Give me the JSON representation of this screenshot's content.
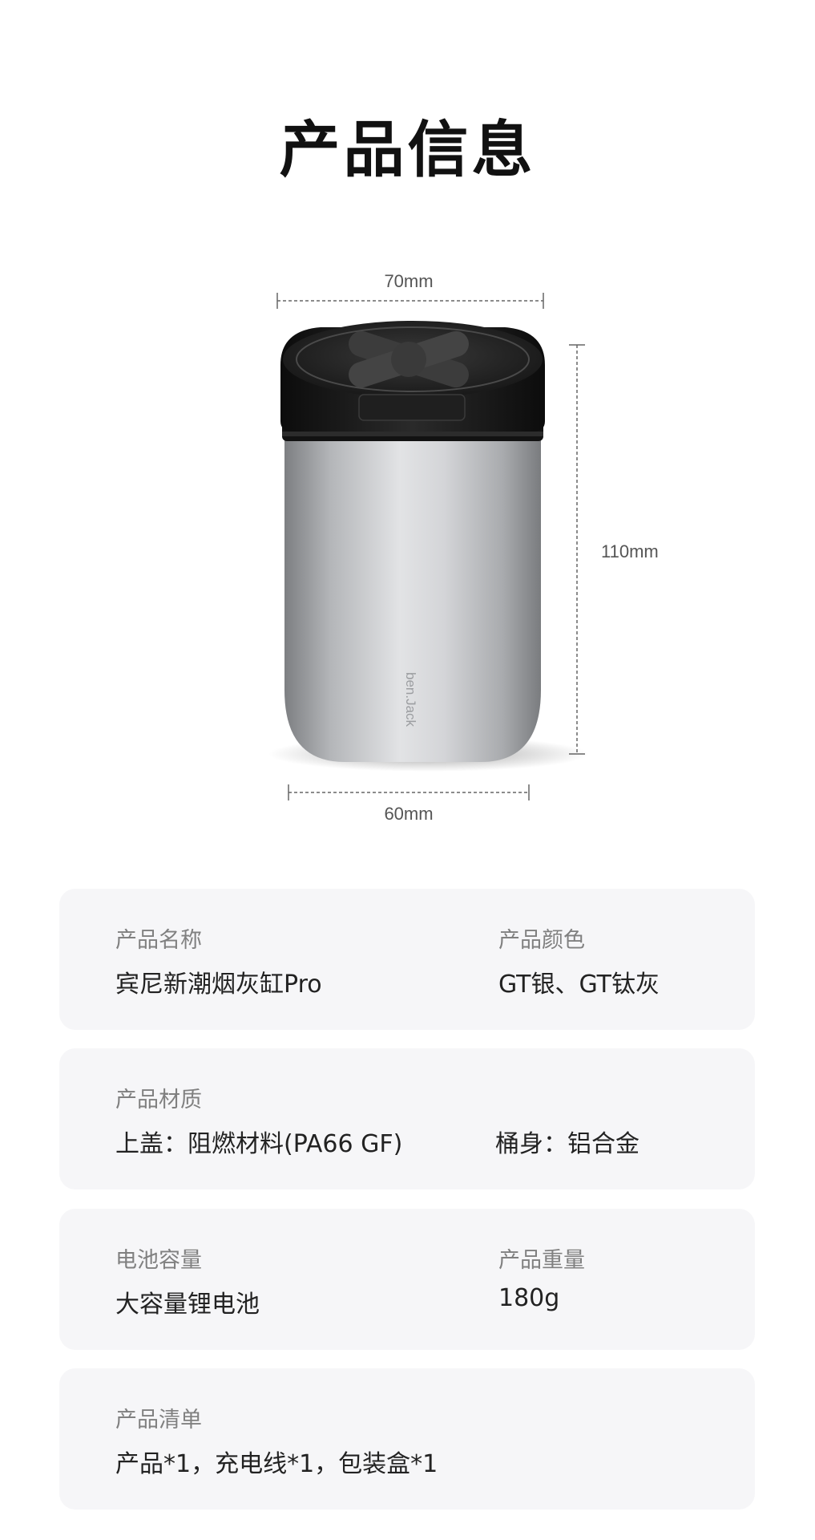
{
  "page": {
    "title": "产品信息"
  },
  "product_image": {
    "brand_mark": "ben.Jack",
    "dimensions": {
      "top_width": "70mm",
      "height": "110mm",
      "bottom_width": "60mm"
    }
  },
  "specs": {
    "name": {
      "label": "产品名称",
      "value": "宾尼新潮烟灰缸Pro"
    },
    "color": {
      "label": "产品颜色",
      "value": "GT银、GT钛灰"
    },
    "material": {
      "label": "产品材质",
      "lid_value": "上盖：阻燃材料(PA66 GF)",
      "body_value": "桶身：铝合金"
    },
    "battery": {
      "label": "电池容量",
      "value": "大容量锂电池"
    },
    "weight": {
      "label": "产品重量",
      "value": "180g"
    },
    "package": {
      "label": "产品清单",
      "value": "产品*1，充电线*1，包装盒*1"
    }
  }
}
